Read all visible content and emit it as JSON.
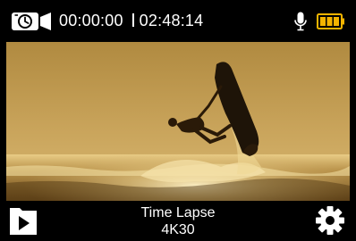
{
  "status": {
    "mode_icon": "timelapse-camera-icon",
    "elapsed": "00:00:00",
    "remaining": "02:48:14",
    "mic_icon": "microphone-icon",
    "battery_icon": "battery-full-icon",
    "battery_color": "#f4b400"
  },
  "viewfinder": {
    "scene": "photo-jetski-rider-sunset"
  },
  "bottom": {
    "play_icon": "playback-icon",
    "mode_label": "Time Lapse",
    "resolution_label": "4K30",
    "settings_icon": "gear-icon"
  }
}
